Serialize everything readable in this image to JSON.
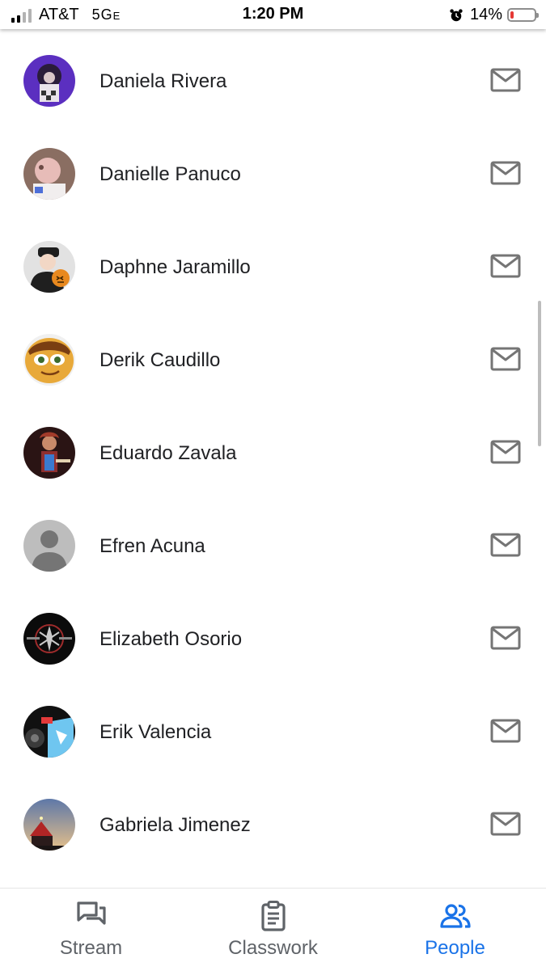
{
  "status_bar": {
    "carrier": "AT&T",
    "network": "5G",
    "network_suffix": "E",
    "time": "1:20 PM",
    "battery_percent_label": "14%",
    "battery_level": 0.14,
    "signal_bars": 4,
    "signal_active": 2
  },
  "people": [
    {
      "name": "Daniela Rivera",
      "avatar": "photo-purple"
    },
    {
      "name": "Danielle Panuco",
      "avatar": "photo-pink"
    },
    {
      "name": "Daphne Jaramillo",
      "avatar": "photo-pumpkin"
    },
    {
      "name": "Derik Caudillo",
      "avatar": "photo-cartoon"
    },
    {
      "name": "Eduardo Zavala",
      "avatar": "photo-dark-red"
    },
    {
      "name": "Efren Acuna",
      "avatar": "default-person"
    },
    {
      "name": "Elizabeth Osorio",
      "avatar": "photo-black-logo"
    },
    {
      "name": "Erik Valencia",
      "avatar": "photo-blue"
    },
    {
      "name": "Gabriela Jimenez",
      "avatar": "photo-sunset"
    }
  ],
  "bottom_nav": {
    "tabs": [
      {
        "label": "Stream",
        "icon": "stream-icon"
      },
      {
        "label": "Classwork",
        "icon": "classwork-icon"
      },
      {
        "label": "People",
        "icon": "people-icon",
        "active": true
      }
    ]
  },
  "colors": {
    "accent": "#1a73e8",
    "inactive": "#5f6368",
    "icon_gray": "#757575",
    "battery_low": "#e53935"
  }
}
